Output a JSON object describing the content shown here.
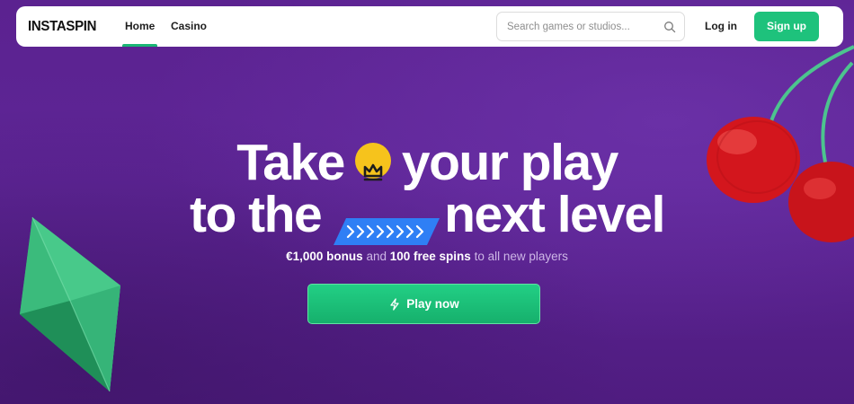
{
  "brand": {
    "logo_text": "INSTASPIN"
  },
  "nav": {
    "items": [
      {
        "label": "Home",
        "active": true
      },
      {
        "label": "Casino",
        "active": false
      }
    ]
  },
  "search": {
    "placeholder": "Search games or studios...",
    "value": "",
    "icon": "search-icon"
  },
  "header_actions": {
    "login_label": "Log in",
    "signup_label": "Sign up"
  },
  "hero": {
    "line1_part1": "Take",
    "line1_part2": "your play",
    "line2_part1": "to the",
    "line2_part2": "next level",
    "crown_icon": "crown-icon",
    "arrow_icon": "chevrons-right-icon",
    "subtitle": {
      "bonus": "€1,000 bonus",
      "and": "and",
      "spins": "100 free spins",
      "rest": "to all new players"
    },
    "cta_label": "Play now",
    "cta_icon": "bolt-icon"
  },
  "colors": {
    "background": "#5b2290",
    "accent_green": "#1ec27c",
    "crown_yellow": "#f6c31c",
    "arrow_blue": "#2f7ff5"
  }
}
